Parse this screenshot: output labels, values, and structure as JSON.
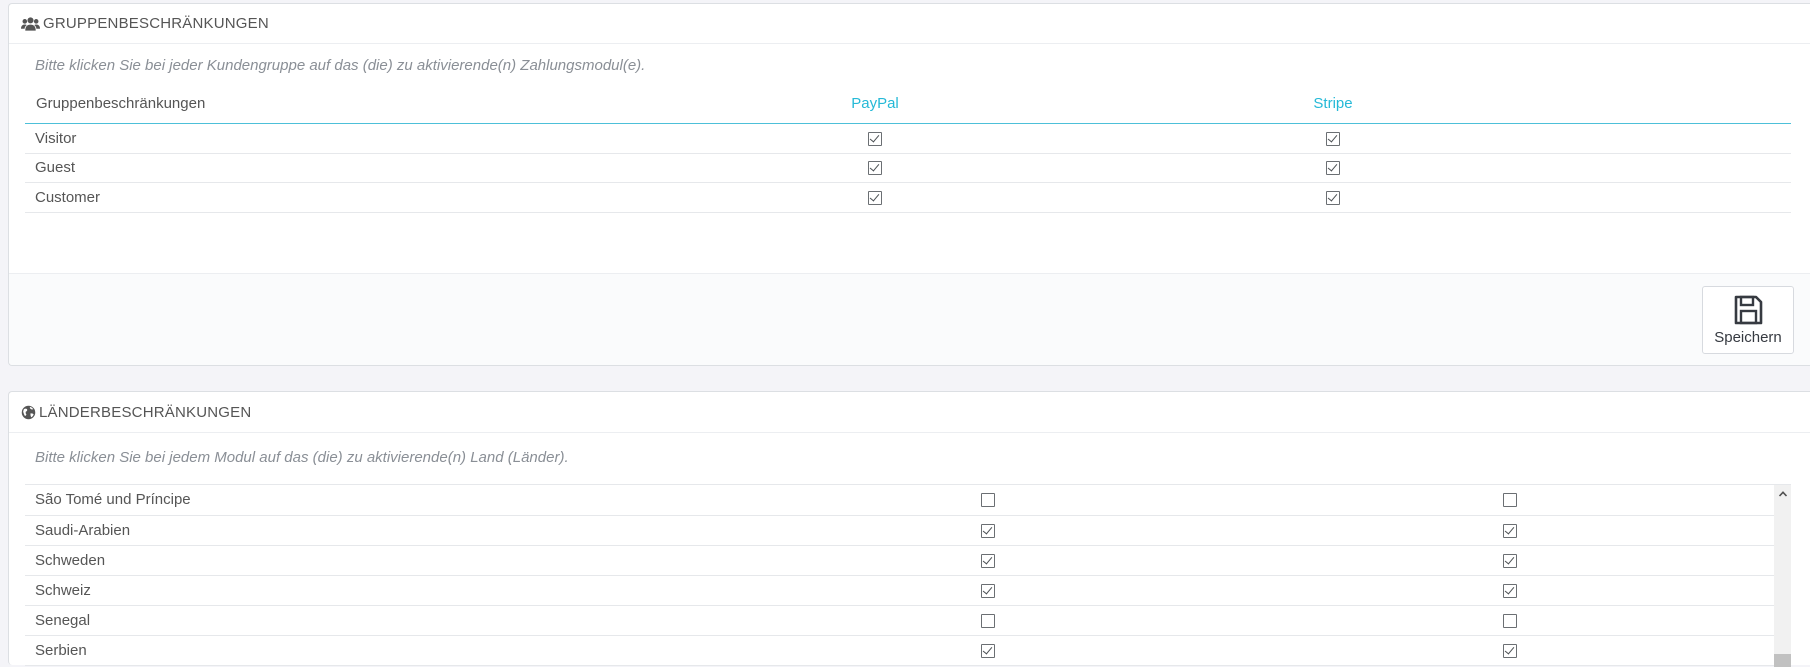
{
  "group_panel": {
    "title": "GRUPPENBESCHRÄNKUNGEN",
    "icon": "users-icon",
    "help_text": "Bitte klicken Sie bei jeder Kundengruppe auf das (die) zu aktivierende(n) Zahlungsmodul(e).",
    "columns": [
      "Gruppenbeschränkungen",
      "PayPal",
      "Stripe"
    ],
    "rows": [
      {
        "name": "Visitor",
        "paypal": true,
        "stripe": true
      },
      {
        "name": "Guest",
        "paypal": true,
        "stripe": true
      },
      {
        "name": "Customer",
        "paypal": true,
        "stripe": true
      }
    ],
    "save_label": "Speichern"
  },
  "country_panel": {
    "title": "LÄNDERBESCHRÄNKUNGEN",
    "icon": "globe-icon",
    "help_text": "Bitte klicken Sie bei jedem Modul auf das (die) zu aktivierende(n) Land (Länder).",
    "rows": [
      {
        "name": "São Tomé und Príncipe",
        "paypal": false,
        "stripe": false
      },
      {
        "name": "Saudi-Arabien",
        "paypal": true,
        "stripe": true
      },
      {
        "name": "Schweden",
        "paypal": true,
        "stripe": true
      },
      {
        "name": "Schweiz",
        "paypal": true,
        "stripe": true
      },
      {
        "name": "Senegal",
        "paypal": false,
        "stripe": false
      },
      {
        "name": "Serbien",
        "paypal": true,
        "stripe": true
      }
    ]
  },
  "colors": {
    "accent": "#25b9d7",
    "text": "#555555",
    "background": "#f4f4f8"
  }
}
